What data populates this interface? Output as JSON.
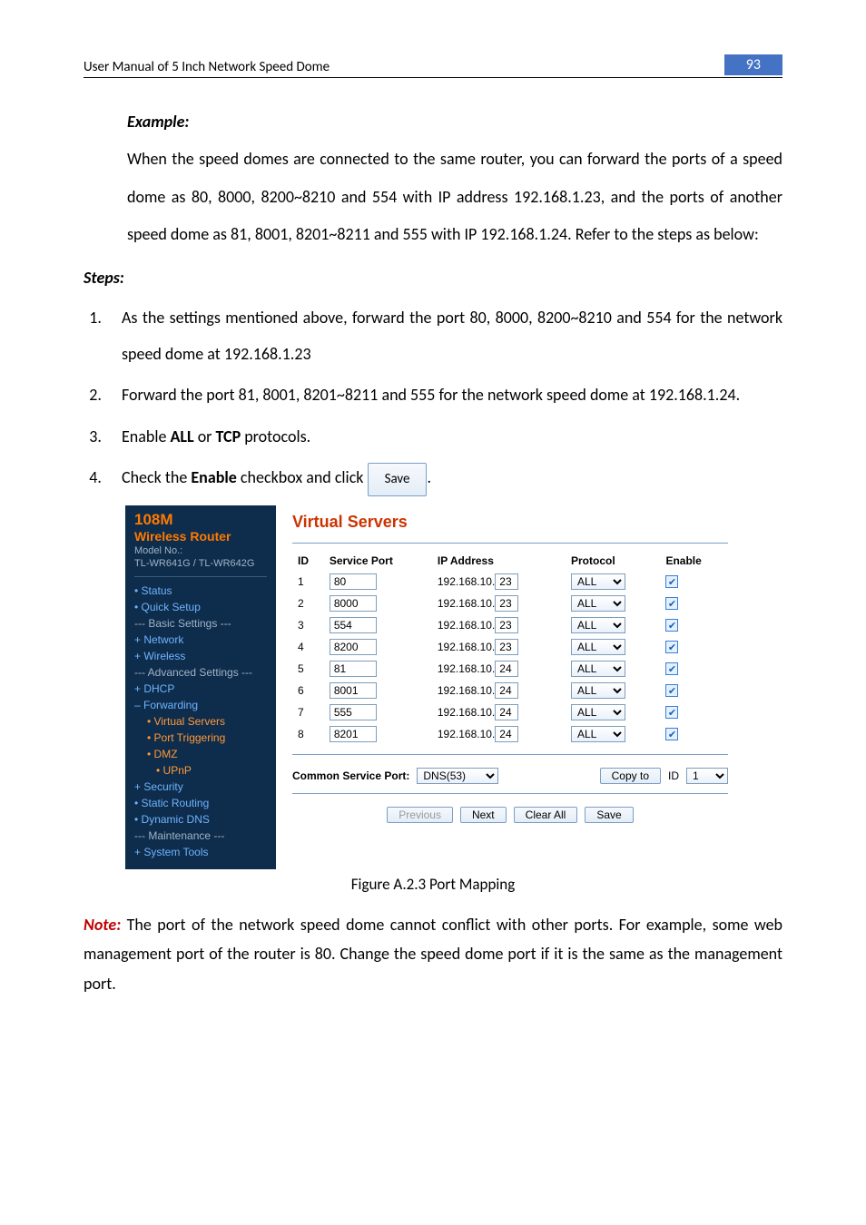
{
  "header": {
    "title": "User Manual of 5 Inch Network Speed Dome",
    "page": "93"
  },
  "example": {
    "label": "Example:",
    "text": "When the speed domes are connected to the same router, you can forward the ports of a speed dome as 80, 8000, 8200~8210 and 554 with IP address 192.168.1.23, and the ports of another speed dome as 81, 8001, 8201~8211 and 555 with IP 192.168.1.24. Refer to the steps as below:"
  },
  "steps_label": "Steps:",
  "steps": [
    "As the settings mentioned above, forward the port 80, 8000, 8200~8210 and 554 for the network speed dome at 192.168.1.23",
    "Forward the port 81, 8001, 8201~8211 and 555 for the network speed dome at 192.168.1.24.",
    {
      "pre": "Enable ",
      "bold": "ALL",
      "mid": " or ",
      "bold2": "TCP",
      "post": " protocols."
    },
    {
      "pre": "Check the ",
      "bold": "Enable",
      "post": " checkbox and click ",
      "btn": "Save",
      "tail": "."
    }
  ],
  "router": {
    "brand1": "108M",
    "brand2": "Wireless  Router",
    "model_label": "Model No.:",
    "model": "TL-WR641G / TL-WR642G",
    "nav": {
      "status": "• Status",
      "quick": "• Quick Setup",
      "basic": "--- Basic Settings ---",
      "network": "+ Network",
      "wireless": "+ Wireless",
      "adv": "--- Advanced Settings ---",
      "dhcp": "+ DHCP",
      "forwarding": "– Forwarding",
      "virtual": "• Virtual Servers",
      "porttrig": "• Port Triggering",
      "dmz": "• DMZ",
      "upnp": "• UPnP",
      "security": "+ Security",
      "static": "• Static Routing",
      "dyn": "• Dynamic DNS",
      "maint": "--- Maintenance ---",
      "sys": "+ System Tools"
    },
    "panel_title": "Virtual Servers",
    "cols": {
      "id": "ID",
      "sp": "Service Port",
      "ip": "IP Address",
      "proto": "Protocol",
      "en": "Enable"
    },
    "ip_prefix": "192.168.10.",
    "rows": [
      {
        "id": "1",
        "port": "80",
        "oct": "23",
        "proto": "ALL"
      },
      {
        "id": "2",
        "port": "8000",
        "oct": "23",
        "proto": "ALL"
      },
      {
        "id": "3",
        "port": "554",
        "oct": "23",
        "proto": "ALL"
      },
      {
        "id": "4",
        "port": "8200",
        "oct": "23",
        "proto": "ALL"
      },
      {
        "id": "5",
        "port": "81",
        "oct": "24",
        "proto": "ALL"
      },
      {
        "id": "6",
        "port": "8001",
        "oct": "24",
        "proto": "ALL"
      },
      {
        "id": "7",
        "port": "555",
        "oct": "24",
        "proto": "ALL"
      },
      {
        "id": "8",
        "port": "8201",
        "oct": "24",
        "proto": "ALL"
      }
    ],
    "common_label": "Common Service Port:",
    "common_value": "DNS(53)",
    "copy_label": "Copy to",
    "copy_id_label": "ID",
    "copy_id_value": "1",
    "buttons": {
      "prev": "Previous",
      "next": "Next",
      "clear": "Clear All",
      "save": "Save"
    }
  },
  "caption": "Figure A.2.3 Port Mapping",
  "note": {
    "label": "Note:",
    "text": " The port of the network speed dome cannot conflict with other ports. For example, some web management port of the router is 80. Change the speed dome port if it is the same as the management port."
  }
}
